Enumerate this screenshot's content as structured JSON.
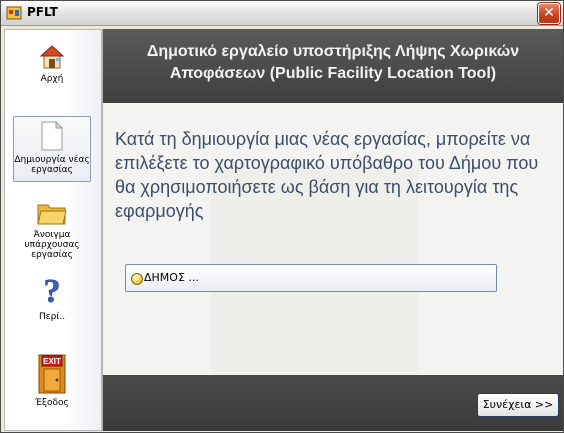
{
  "window": {
    "title": "PFLT"
  },
  "sidebar": {
    "items": [
      {
        "label": "Αρχή",
        "icon": "home-icon"
      },
      {
        "label": "Δημιουργία νέας εργασίας",
        "icon": "document-icon"
      },
      {
        "label": "Άνοιγμα υπάρχουσας εργασίας",
        "icon": "folder-icon"
      },
      {
        "label": "Περί..",
        "icon": "help-icon"
      },
      {
        "label": "Έξοδος",
        "icon": "exit-door-icon"
      }
    ]
  },
  "header": {
    "title": "Δημοτικό εργαλείο υποστήριξης Λήψης Χωρικών Αποφάσεων (Public Facility Location Tool)"
  },
  "main": {
    "description": "Κατά τη δημιουργία μιας νέας εργασίας, μπορείτε να επιλέξετε το χαρτογραφικό υπόβαθρο του Δήμου που θα χρησιμοποιήσετε ως βάση για τη λειτουργία της εφαρμογής",
    "municipality_option": "ΔΗΜΟΣ ..."
  },
  "footer": {
    "continue_label": "Συνέχεια >>"
  }
}
